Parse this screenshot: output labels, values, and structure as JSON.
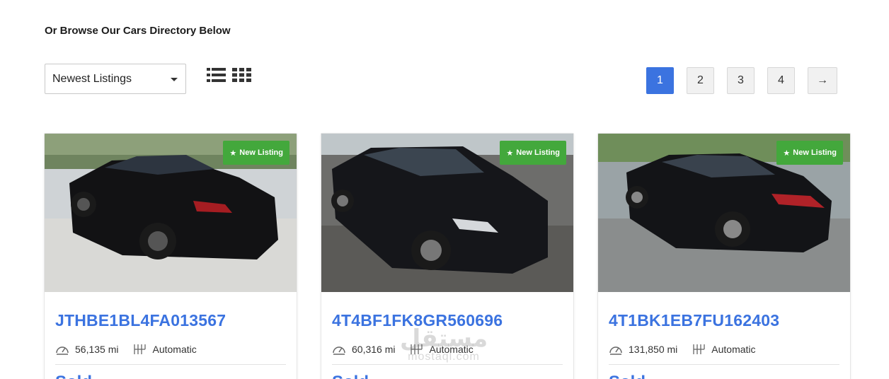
{
  "heading": "Or Browse Our Cars Directory Below",
  "sort": {
    "selected": "Newest Listings"
  },
  "view_toggle": {
    "list_icon": "list-view-icon",
    "grid_icon": "grid-view-icon"
  },
  "pagination": {
    "pages": [
      "1",
      "2",
      "3",
      "4"
    ],
    "next": "→",
    "active": "1"
  },
  "listings": [
    {
      "badge": "New Listing",
      "vin": "JTHBE1BL4FA013567",
      "mileage": "56,135 mi",
      "transmission": "Automatic",
      "status": "Sold"
    },
    {
      "badge": "New Listing",
      "vin": "4T4BF1FK8GR560696",
      "mileage": "60,316 mi",
      "transmission": "Automatic",
      "status": "Sold"
    },
    {
      "badge": "New Listing",
      "vin": "4T1BK1EB7FU162403",
      "mileage": "131,850 mi",
      "transmission": "Automatic",
      "status": "Sold"
    }
  ],
  "watermark": {
    "arabic": "مستقل",
    "latin": "mostaql.com"
  },
  "colors": {
    "accent": "#3b73e0",
    "badge": "#43a83c"
  }
}
